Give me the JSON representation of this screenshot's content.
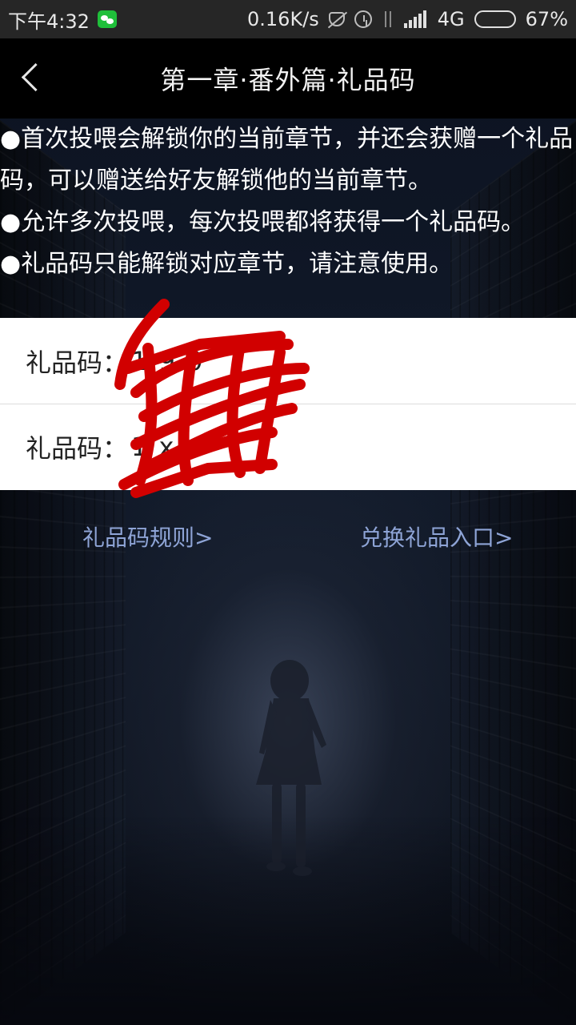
{
  "status_bar": {
    "time": "下午4:32",
    "net_speed": "0.16K/s",
    "network": "4G",
    "battery": "67%",
    "battery_level": 0.67,
    "icons": [
      "wechat-icon",
      "mute-icon",
      "alarm-icon",
      "data-icon",
      "signal-icon",
      "battery-icon"
    ]
  },
  "header": {
    "title": "第一章·番外篇·礼品码",
    "back_icon": "back-icon"
  },
  "rules": [
    "●首次投喂会解锁你的当前章节，并还会获赠一个礼品码，可以赠送给好友解锁他的当前章节。",
    "●允许多次投喂，每次投喂都将获得一个礼品码。",
    "●礼品码只能解锁对应章节，请注意使用。"
  ],
  "gift_codes": [
    {
      "label": "礼品码：",
      "value": "1    9         0"
    },
    {
      "label": "礼品码：",
      "value": "1              x"
    }
  ],
  "links": {
    "rules": "礼品码规则>",
    "exchange": "兑换礼品入口>"
  },
  "colors": {
    "status_bg": "#262626",
    "nav_bg": "#000000",
    "link": "#8ea4d6",
    "scribble": "#d10000"
  }
}
